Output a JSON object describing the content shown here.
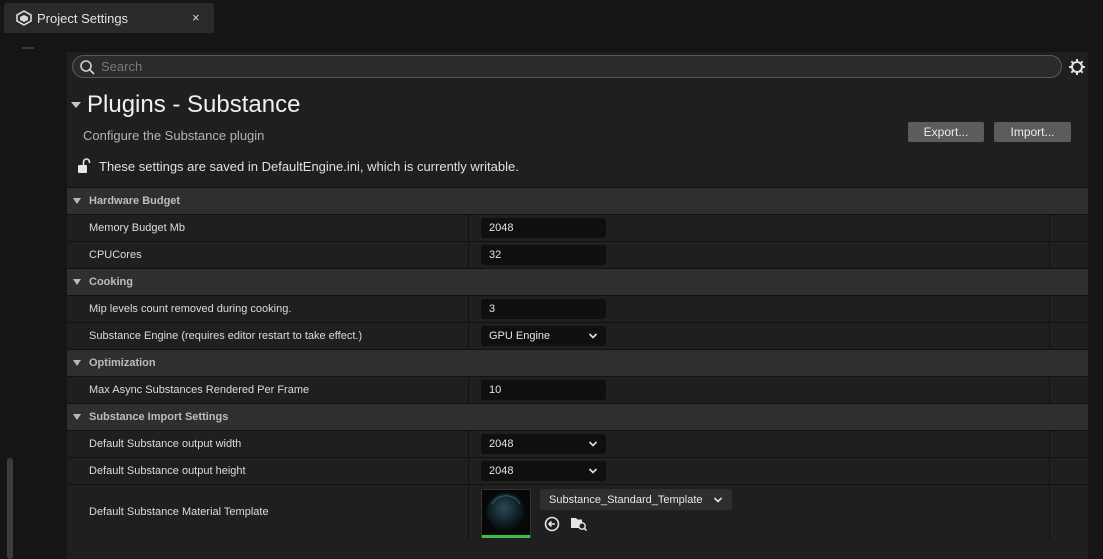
{
  "window": {
    "tab_title": "Project Settings",
    "tab_close": "×"
  },
  "search": {
    "placeholder": "Search",
    "value": ""
  },
  "header": {
    "title": "Plugins - Substance",
    "description": "Configure the Substance plugin",
    "export_label": "Export...",
    "import_label": "Import...",
    "saved_note": "These settings are saved in DefaultEngine.ini, which is currently writable."
  },
  "categories": {
    "hardware_budget": {
      "label": "Hardware Budget",
      "memory_budget": {
        "name": "Memory Budget Mb",
        "value": "2048"
      },
      "cpu_cores": {
        "name": "CPUCores",
        "value": "32"
      }
    },
    "cooking": {
      "label": "Cooking",
      "mip_levels": {
        "name": "Mip levels count removed during cooking.",
        "value": "3"
      },
      "substance_engine": {
        "name": "Substance Engine (requires editor restart to take effect.)",
        "value": "GPU Engine"
      }
    },
    "optimization": {
      "label": "Optimization",
      "max_async": {
        "name": "Max Async Substances Rendered Per Frame",
        "value": "10"
      }
    },
    "import_settings": {
      "label": "Substance Import Settings",
      "output_width": {
        "name": "Default Substance output width",
        "value": "2048"
      },
      "output_height": {
        "name": "Default Substance output height",
        "value": "2048"
      },
      "material_template": {
        "name": "Default Substance Material Template",
        "value": "Substance_Standard_Template"
      }
    }
  },
  "icons": {
    "app": "unreal-engine-icon",
    "search": "search-icon",
    "settings": "gear-icon",
    "lock": "unlock-icon",
    "collapse": "triangle-down-icon",
    "dropdown": "chevron-down-icon",
    "use_selected": "use-selected-asset-icon",
    "browse": "browse-folder-icon"
  },
  "colors": {
    "background": "#151515",
    "panel": "#1f1f1f",
    "category": "#2f2f2f",
    "field": "#0f0f0f",
    "button": "#5c5c5c",
    "thumbnail_accent": "#3fbf4a"
  }
}
